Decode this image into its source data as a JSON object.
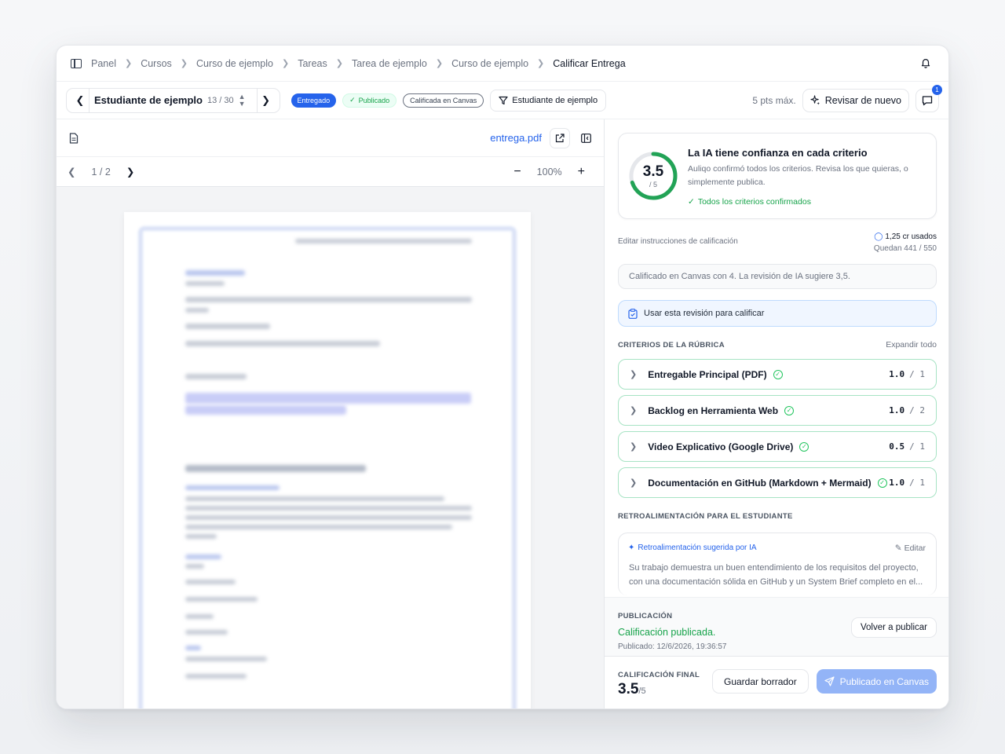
{
  "breadcrumb": [
    "Panel",
    "Cursos",
    "Curso de ejemplo",
    "Tareas",
    "Tarea de ejemplo",
    "Curso de ejemplo",
    "Calificar Entrega"
  ],
  "toolbar": {
    "student_name": "Estudiante de ejemplo",
    "student_count": "13 / 30",
    "status_submitted": "Entregado",
    "status_published": "Publicado",
    "status_canvas": "Calificada en Canvas",
    "filter_label": "Estudiante de ejemplo",
    "max_points": "5 pts máx.",
    "review_again": "Revisar de nuevo",
    "chat_badge": "1"
  },
  "viewer": {
    "file_name": "entrega.pdf",
    "page_indicator": "1 / 2",
    "zoom": "100%"
  },
  "confidence": {
    "score": "3.5",
    "max": "/ 5",
    "score_fraction": 0.7,
    "title": "La IA tiene confianza en cada criterio",
    "description": "Auliqo confirmó todos los criterios. Revisa los que quieras, o simplemente publica.",
    "status": "Todos los criterios confirmados"
  },
  "grading": {
    "edit_instructions": "Editar instrucciones de calificación",
    "credits_used": "1,25 cr usados",
    "credits_remaining": "Quedan 441 / 550",
    "canvas_note": "Calificado en Canvas con 4. La revisión de IA sugiere 3,5.",
    "use_review": "Usar esta revisión para calificar"
  },
  "rubric": {
    "title": "CRITERIOS DE LA RÚBRICA",
    "expand_all": "Expandir todo",
    "criteria": [
      {
        "label": "Entregable Principal (PDF)",
        "score": "1.0",
        "max": "/ 1"
      },
      {
        "label": "Backlog en Herramienta Web",
        "score": "1.0",
        "max": "/ 2"
      },
      {
        "label": "Video Explicativo (Google Drive)",
        "score": "0.5",
        "max": "/ 1"
      },
      {
        "label": "Documentación en GitHub (Markdown + Mermaid)",
        "score": "1.0",
        "max": "/ 1"
      }
    ]
  },
  "feedback": {
    "title": "RETROALIMENTACIÓN PARA EL ESTUDIANTE",
    "ai_label": "Retroalimentación sugerida por IA",
    "edit": "Editar",
    "text": "Su trabajo demuestra un buen entendimiento de los requisitos del proyecto, con una documentación sólida en GitHub y un System Brief completo en el..."
  },
  "publication": {
    "title": "PUBLICACIÓN",
    "status": "Calificación publicada.",
    "date": "Publicado: 12/6/2026, 19:36:57",
    "republish": "Volver a publicar"
  },
  "final_grade": {
    "title": "CALIFICACIÓN FINAL",
    "value": "3.5",
    "max": "/5",
    "save_draft": "Guardar borrador",
    "posted": "Publicado en Canvas"
  },
  "colors": {
    "accent": "#2563eb",
    "success": "#16a34a",
    "ring": "#22a356"
  }
}
